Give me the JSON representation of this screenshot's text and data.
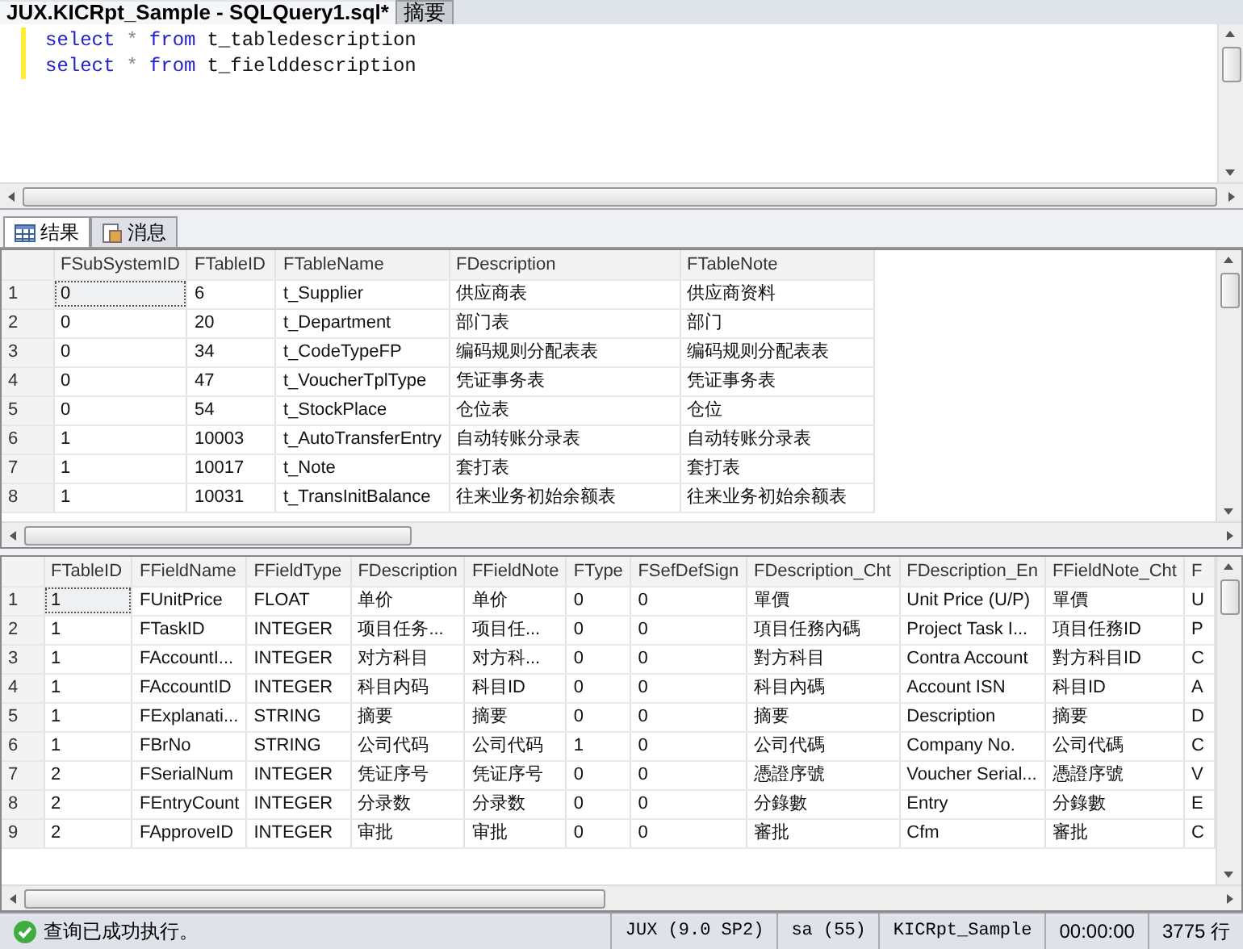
{
  "document_tabs": [
    {
      "label": "JUX.KICRpt_Sample - SQLQuery1.sql*",
      "selected": true
    },
    {
      "label": "摘要",
      "selected": false
    }
  ],
  "editor": {
    "lines": [
      [
        {
          "kind": "keyword",
          "text": "select"
        },
        {
          "kind": "operator",
          "text": "*"
        },
        {
          "kind": "keyword",
          "text": "from"
        },
        {
          "kind": "identifier",
          "text": "t_tabledescription"
        }
      ],
      [
        {
          "kind": "keyword",
          "text": "select"
        },
        {
          "kind": "operator",
          "text": "*"
        },
        {
          "kind": "keyword",
          "text": "from"
        },
        {
          "kind": "identifier",
          "text": "t_fielddescription"
        }
      ]
    ]
  },
  "result_tabs": [
    {
      "label": "结果",
      "selected": true
    },
    {
      "label": "消息",
      "selected": false
    }
  ],
  "grids": [
    {
      "columns": [
        "FSubSystemID",
        "FTableID",
        "FTableName",
        "FDescription",
        "FTableNote"
      ],
      "rows": [
        {
          "number": "1",
          "selected": true,
          "cells": [
            "0",
            "6",
            "t_Supplier",
            "供应商表",
            "供应商资料"
          ]
        },
        {
          "number": "2",
          "selected": false,
          "cells": [
            "0",
            "20",
            "t_Department",
            "部门表",
            "部门"
          ]
        },
        {
          "number": "3",
          "selected": false,
          "cells": [
            "0",
            "34",
            "t_CodeTypeFP",
            "编码规则分配表表",
            "编码规则分配表表"
          ]
        },
        {
          "number": "4",
          "selected": false,
          "cells": [
            "0",
            "47",
            "t_VoucherTplType",
            "凭证事务表",
            "凭证事务表"
          ]
        },
        {
          "number": "5",
          "selected": false,
          "cells": [
            "0",
            "54",
            "t_StockPlace",
            "仓位表",
            "仓位"
          ]
        },
        {
          "number": "6",
          "selected": false,
          "cells": [
            "1",
            "10003",
            "t_AutoTransferEntry",
            "自动转账分录表",
            "自动转账分录表"
          ]
        },
        {
          "number": "7",
          "selected": false,
          "cells": [
            "1",
            "10017",
            "t_Note",
            "套打表",
            "套打表"
          ]
        },
        {
          "number": "8",
          "selected": false,
          "cells": [
            "1",
            "10031",
            "t_TransInitBalance",
            "往来业务初始余额表",
            "往来业务初始余额表"
          ]
        }
      ]
    },
    {
      "columns": [
        "FTableID",
        "FFieldName",
        "FFieldType",
        "FDescription",
        "FFieldNote",
        "FType",
        "FSefDefSign",
        "FDescription_Cht",
        "FDescription_En",
        "FFieldNote_Cht",
        "F"
      ],
      "rows": [
        {
          "number": "1",
          "selected": true,
          "cells": [
            "1",
            "FUnitPrice",
            "FLOAT",
            "单价",
            "单价",
            "0",
            "0",
            "單價",
            "Unit Price (U/P)",
            "單價",
            "U"
          ]
        },
        {
          "number": "2",
          "selected": false,
          "cells": [
            "1",
            "FTaskID",
            "INTEGER",
            "项目任务...",
            "项目任...",
            "0",
            "0",
            "項目任務內碼",
            "Project Task I...",
            "項目任務ID",
            "P"
          ]
        },
        {
          "number": "3",
          "selected": false,
          "cells": [
            "1",
            "FAccountI...",
            "INTEGER",
            "对方科目",
            "对方科...",
            "0",
            "0",
            "對方科目",
            "Contra Account",
            "對方科目ID",
            "C"
          ]
        },
        {
          "number": "4",
          "selected": false,
          "cells": [
            "1",
            "FAccountID",
            "INTEGER",
            "科目内码",
            "科目ID",
            "0",
            "0",
            "科目內碼",
            "Account ISN",
            "科目ID",
            "A"
          ]
        },
        {
          "number": "5",
          "selected": false,
          "cells": [
            "1",
            "FExplanati...",
            "STRING",
            "摘要",
            "摘要",
            "0",
            "0",
            "摘要",
            "Description",
            "摘要",
            "D"
          ]
        },
        {
          "number": "6",
          "selected": false,
          "cells": [
            "1",
            "FBrNo",
            "STRING",
            "公司代码",
            "公司代码",
            "1",
            "0",
            "公司代碼",
            "Company No.",
            "公司代碼",
            "C"
          ]
        },
        {
          "number": "7",
          "selected": false,
          "cells": [
            "2",
            "FSerialNum",
            "INTEGER",
            "凭证序号",
            "凭证序号",
            "0",
            "0",
            "憑證序號",
            "Voucher Serial...",
            "憑證序號",
            "V"
          ]
        },
        {
          "number": "8",
          "selected": false,
          "cells": [
            "2",
            "FEntryCount",
            "INTEGER",
            "分录数",
            "分录数",
            "0",
            "0",
            "分錄數",
            "Entry",
            "分錄數",
            "E"
          ]
        },
        {
          "number": "9",
          "selected": false,
          "cells": [
            "2",
            "FApproveID",
            "INTEGER",
            "审批",
            "审批",
            "0",
            "0",
            "審批",
            "Cfm",
            "審批",
            "C"
          ]
        }
      ]
    }
  ],
  "status_bar": {
    "message": "查询已成功执行。",
    "server": "JUX (9.0 SP2)",
    "user": "sa (55)",
    "database": "KICRpt_Sample",
    "elapsed": "00:00:00",
    "row_count": "3775 行"
  }
}
